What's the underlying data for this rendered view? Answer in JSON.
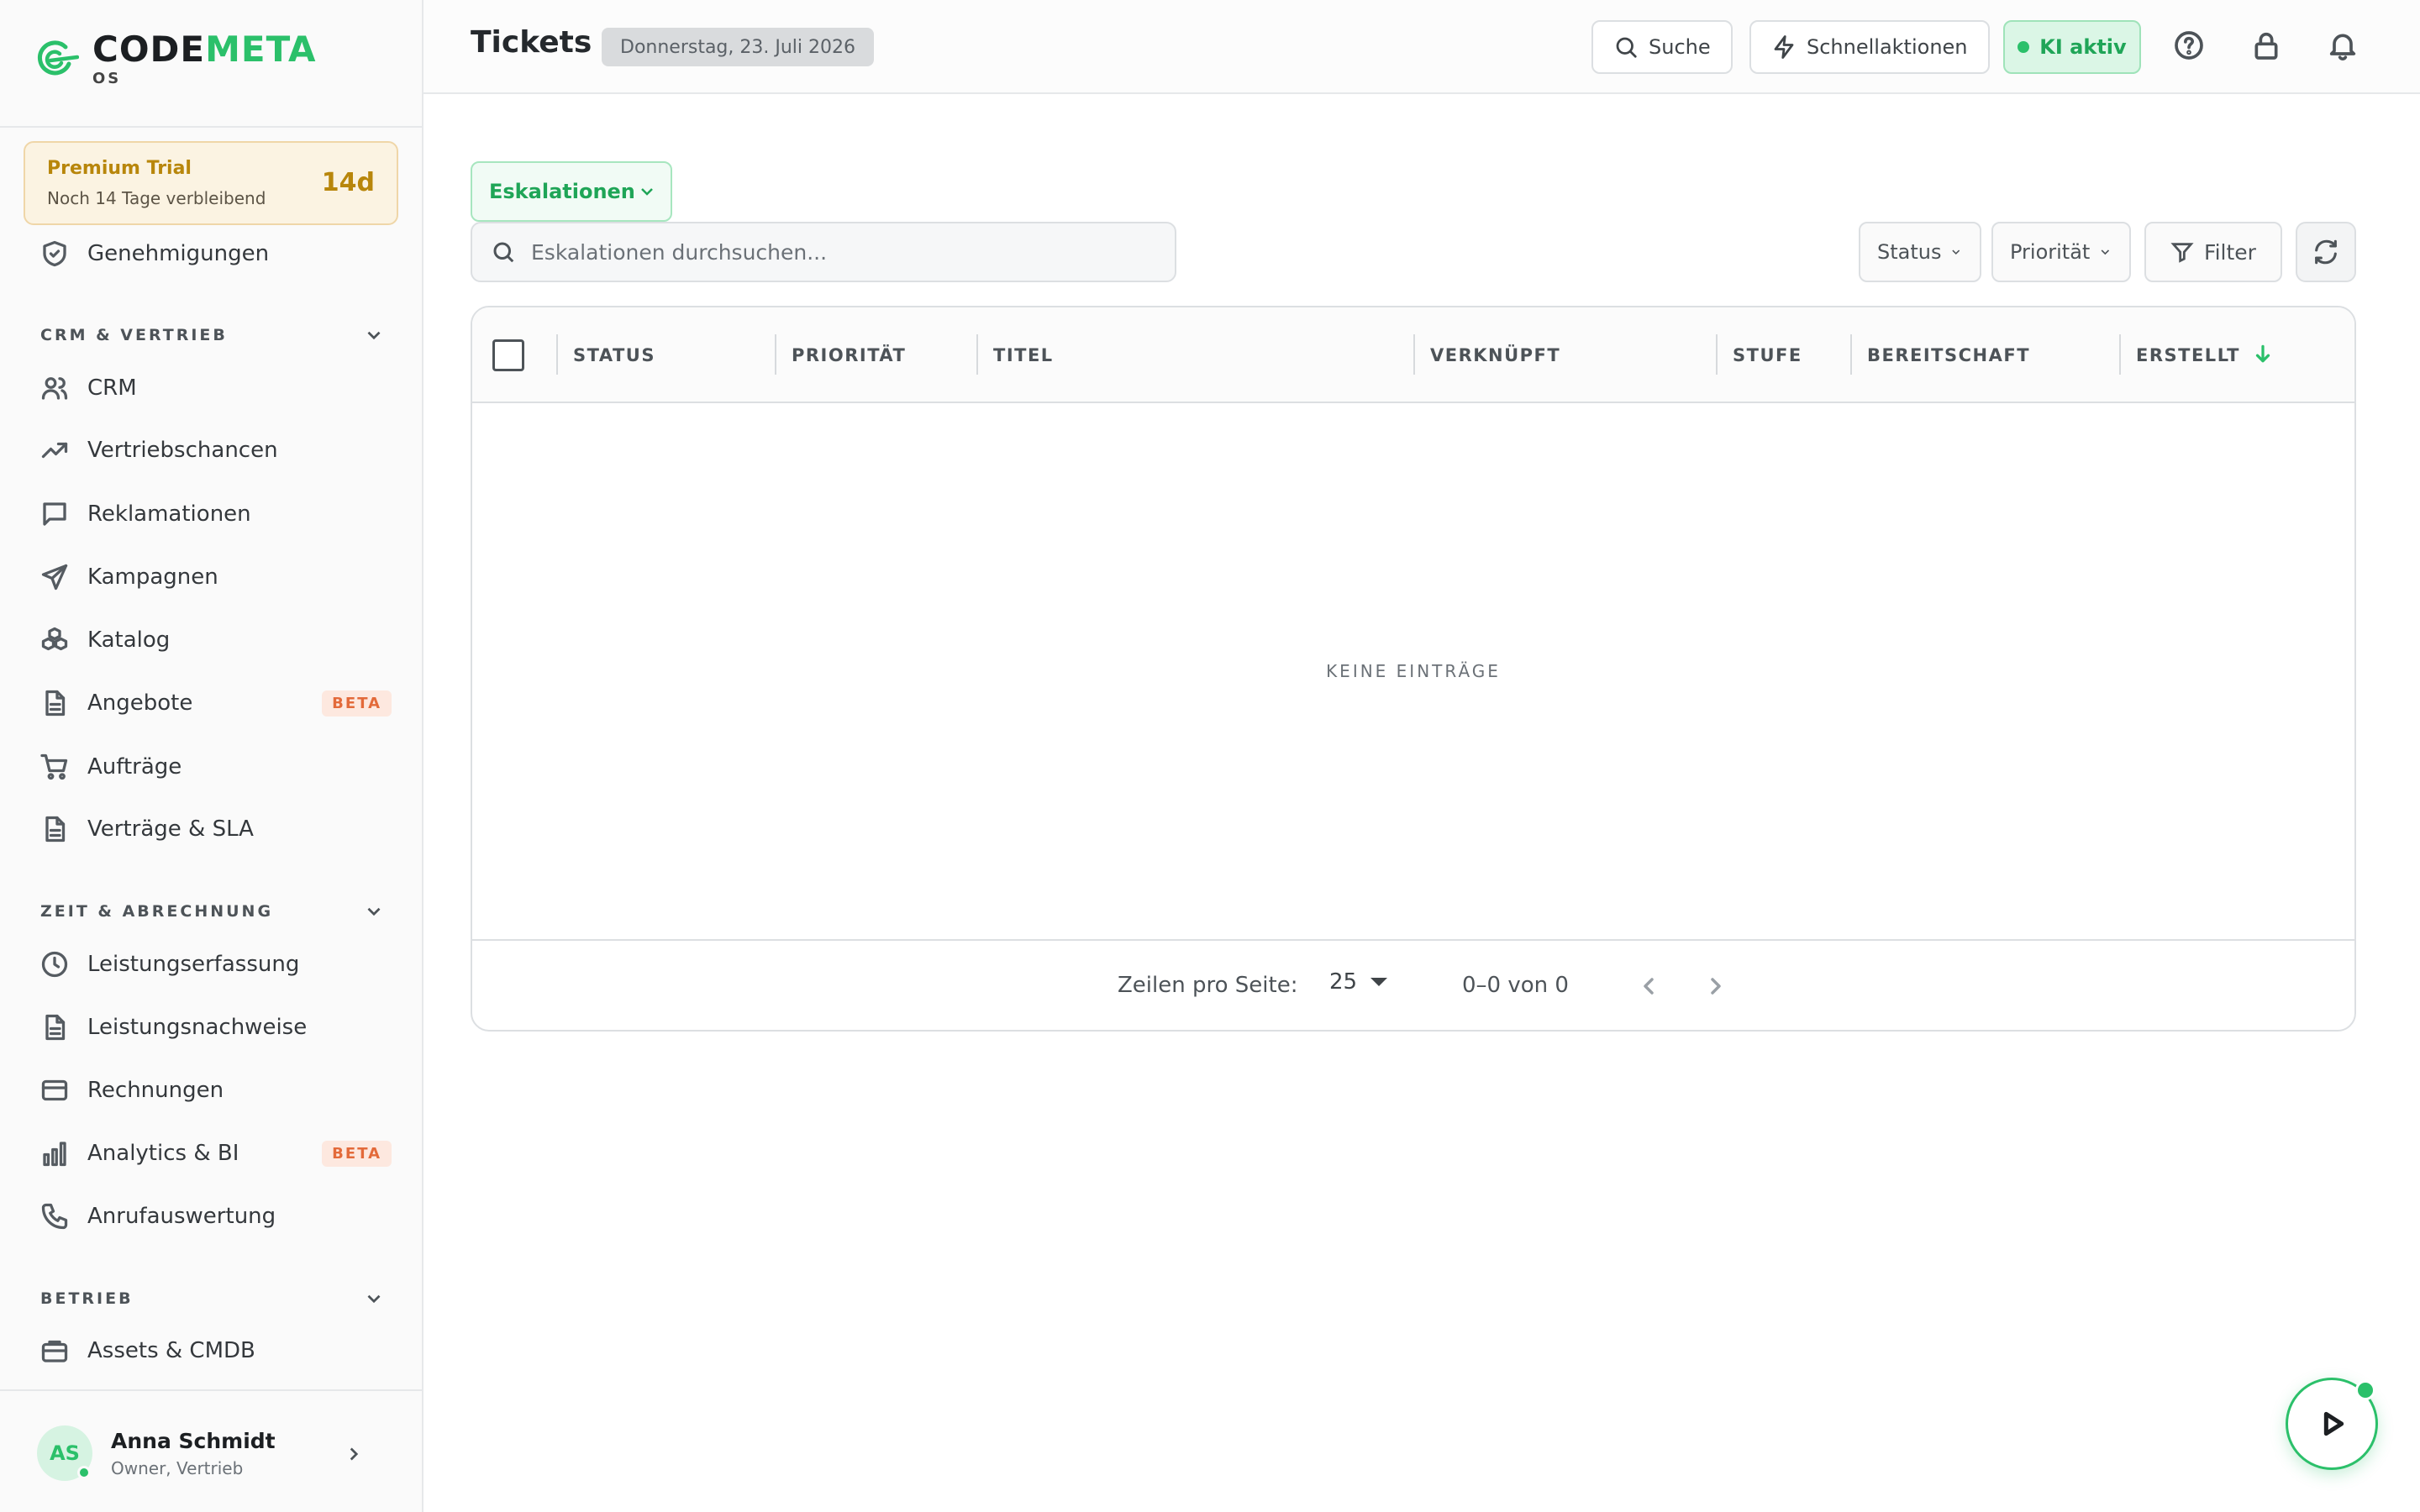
{
  "brand": {
    "word_a": "CODE",
    "word_b": "META",
    "sub": "OS"
  },
  "trial": {
    "title": "Premium Trial",
    "subtitle": "Noch 14 Tage verbleibend",
    "days": "14d"
  },
  "sidebar": {
    "top_item": "Genehmigungen",
    "sections": [
      {
        "title": "CRM & VERTRIEB",
        "items": [
          {
            "label": "CRM",
            "icon": "users-icon"
          },
          {
            "label": "Vertriebschancen",
            "icon": "trending-up-icon"
          },
          {
            "label": "Reklamationen",
            "icon": "message-square-icon"
          },
          {
            "label": "Kampagnen",
            "icon": "send-icon"
          },
          {
            "label": "Katalog",
            "icon": "boxes-icon"
          },
          {
            "label": "Angebote",
            "icon": "file-text-icon",
            "badge": "BETA"
          },
          {
            "label": "Aufträge",
            "icon": "cart-icon"
          },
          {
            "label": "Verträge & SLA",
            "icon": "file-text-icon"
          }
        ]
      },
      {
        "title": "ZEIT & ABRECHNUNG",
        "items": [
          {
            "label": "Leistungserfassung",
            "icon": "clock-icon"
          },
          {
            "label": "Leistungsnachweise",
            "icon": "file-text-icon"
          },
          {
            "label": "Rechnungen",
            "icon": "credit-card-icon"
          },
          {
            "label": "Analytics & BI",
            "icon": "bar-chart-icon",
            "badge": "BETA"
          },
          {
            "label": "Anrufauswertung",
            "icon": "phone-icon"
          }
        ]
      },
      {
        "title": "BETRIEB",
        "items": [
          {
            "label": "Assets & CMDB",
            "icon": "briefcase-icon"
          }
        ]
      }
    ]
  },
  "user": {
    "initials": "AS",
    "name": "Anna Schmidt",
    "role": "Owner, Vertrieb"
  },
  "header": {
    "title": "Tickets",
    "date": "Donnerstag, 23. Juli 2026",
    "search_label": "Suche",
    "quick_actions_label": "Schnellaktionen",
    "ai_label": "KI aktiv"
  },
  "toolbar": {
    "view_label": "Eskalationen",
    "search_placeholder": "Eskalationen durchsuchen...",
    "status_label": "Status",
    "priority_label": "Priorität",
    "filter_label": "Filter"
  },
  "table": {
    "columns": [
      "STATUS",
      "PRIORITÄT",
      "TITEL",
      "VERKNÜPFT",
      "STUFE",
      "BEREITSCHAFT",
      "ERSTELLT"
    ],
    "empty_text": "KEINE EINTRÄGE",
    "rows_label": "Zeilen pro Seite:",
    "rows_value": "25",
    "range_text": "0–0 von 0"
  },
  "colors": {
    "accent": "#2bc06a",
    "trial": "#b8860b",
    "beta": "#e36a3a"
  }
}
